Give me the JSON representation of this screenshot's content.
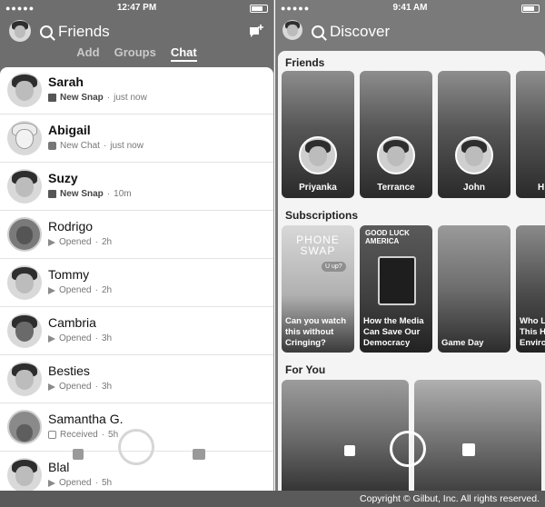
{
  "left": {
    "status": {
      "time": "12:47 PM"
    },
    "title": "Friends",
    "tabs": [
      {
        "label": "Add",
        "active": false
      },
      {
        "label": "Groups",
        "active": false
      },
      {
        "label": "Chat",
        "active": true
      }
    ],
    "chats": [
      {
        "name": "Sarah",
        "bold": true,
        "status_icon": "new-snap-icon",
        "status": "New Snap",
        "time": "just now"
      },
      {
        "name": "Abigail",
        "bold": true,
        "status_icon": "new-chat-icon",
        "status": "New Chat",
        "time": "just now"
      },
      {
        "name": "Suzy",
        "bold": true,
        "status_icon": "new-snap-icon",
        "status": "New Snap",
        "time": "10m"
      },
      {
        "name": "Rodrigo",
        "bold": false,
        "status_icon": "opened-arrow-icon",
        "status": "Opened",
        "time": "2h"
      },
      {
        "name": "Tommy",
        "bold": false,
        "status_icon": "opened-arrow-icon",
        "status": "Opened",
        "time": "2h"
      },
      {
        "name": "Cambria",
        "bold": false,
        "status_icon": "opened-arrow-icon",
        "status": "Opened",
        "time": "3h"
      },
      {
        "name": "Besties",
        "bold": false,
        "status_icon": "opened-arrow-icon",
        "status": "Opened",
        "time": "3h"
      },
      {
        "name": "Samantha G.",
        "bold": false,
        "status_icon": "received-chat-icon",
        "status": "Received",
        "time": "5h"
      },
      {
        "name": "Blal",
        "bold": false,
        "status_icon": "opened-arrow-icon",
        "status": "Opened",
        "time": "5h"
      }
    ]
  },
  "right": {
    "status": {
      "time": "9:41 AM"
    },
    "title": "Discover",
    "sections": {
      "friends": "Friends",
      "subscriptions": "Subscriptions",
      "for_you": "For You"
    },
    "friends": [
      {
        "name": "Priyanka"
      },
      {
        "name": "Terrance"
      },
      {
        "name": "John"
      },
      {
        "name": "H"
      }
    ],
    "subscriptions": [
      {
        "title": "Can you watch this without Cringing?",
        "art_text": "PHONE SWAP",
        "bubble": "U up?"
      },
      {
        "title": "How the Media Can Save Our Democracy",
        "art_text": "GOOD LUCK AMERICA"
      },
      {
        "title": "Game Day"
      },
      {
        "title": "Who L This H Enviro"
      }
    ]
  },
  "footer": {
    "copyright": "Copyright © Gilbut, Inc. All rights reserved."
  }
}
